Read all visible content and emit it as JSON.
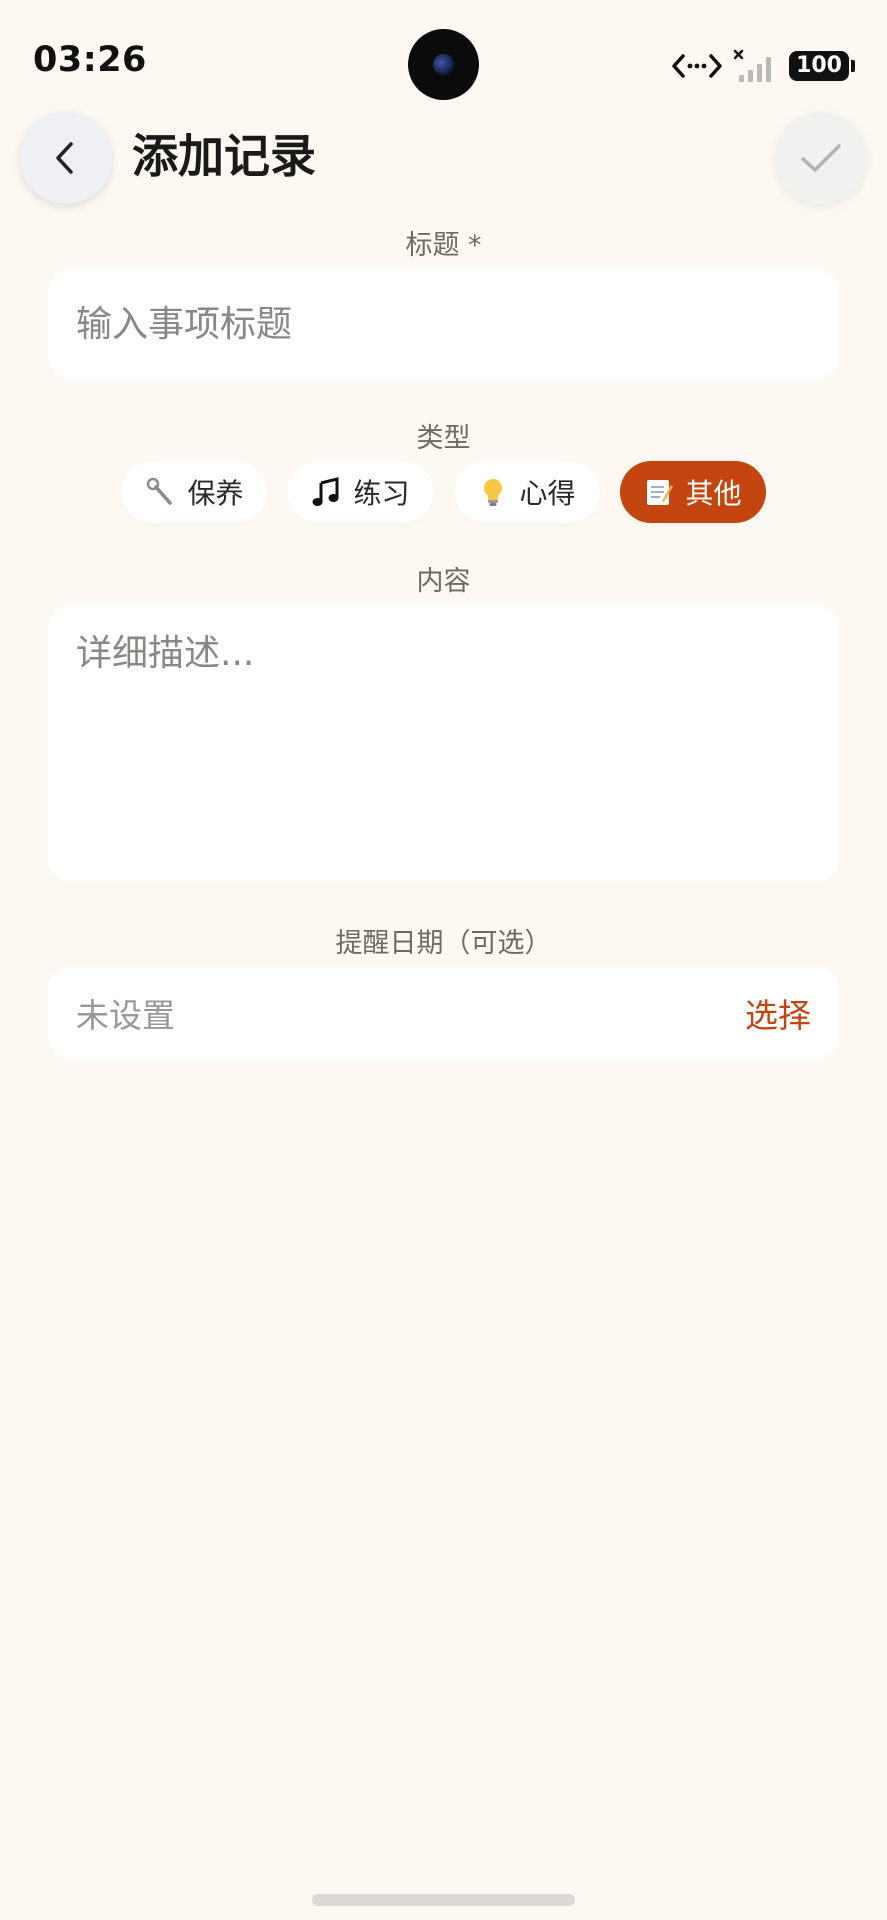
{
  "status_bar": {
    "time": "03:26",
    "battery": "100",
    "network_icon": "data-transfer-icon",
    "signal_icon": "no-signal-icon"
  },
  "header": {
    "title": "添加记录",
    "back_icon": "chevron-left-icon",
    "confirm_icon": "checkmark-icon"
  },
  "form": {
    "title_label": "标题 *",
    "title_placeholder": "输入事项标题",
    "title_value": "",
    "type_label": "类型",
    "types": [
      {
        "icon": "wrench-icon",
        "label": "保养",
        "selected": false
      },
      {
        "icon": "music-note-icon",
        "label": "练习",
        "selected": false
      },
      {
        "icon": "lightbulb-icon",
        "label": "心得",
        "selected": false
      },
      {
        "icon": "memo-icon",
        "label": "其他",
        "selected": true
      }
    ],
    "content_label": "内容",
    "content_placeholder": "详细描述...",
    "content_value": "",
    "reminder_label": "提醒日期（可选）",
    "reminder_value": "未设置",
    "reminder_action": "选择"
  },
  "colors": {
    "background": "#fdf9f2",
    "accent": "#c4450f",
    "card": "#ffffff"
  }
}
